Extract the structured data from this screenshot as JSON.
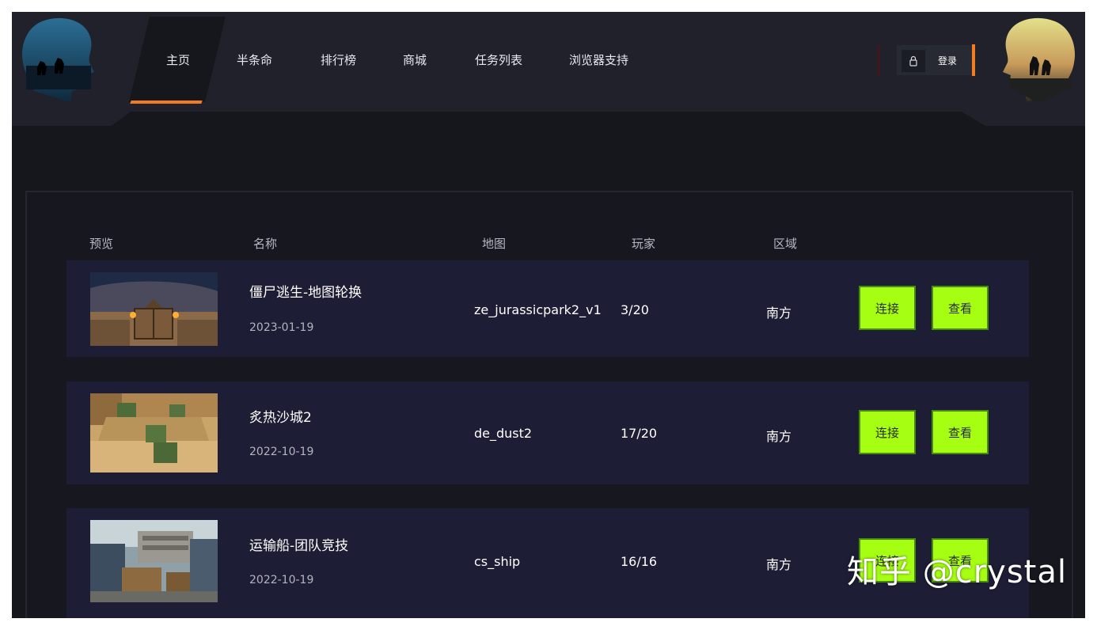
{
  "nav": {
    "items": [
      "主页",
      "半条命",
      "排行榜",
      "商城",
      "任务列表",
      "浏览器支持"
    ],
    "active_index": 0
  },
  "login": {
    "label": "登录",
    "icon": "lock-icon"
  },
  "table": {
    "headers": [
      "预览",
      "名称",
      "地图",
      "玩家",
      "区域"
    ],
    "rows": [
      {
        "name": "僵尸逃生-地图轮换",
        "date": "2023-01-19",
        "map": "ze_jurassicpark2_v1",
        "players": "3/20",
        "region": "南方",
        "connect": "连接",
        "view": "查看"
      },
      {
        "name": "炙热沙城2",
        "date": "2022-10-19",
        "map": "de_dust2",
        "players": "17/20",
        "region": "南方",
        "connect": "连接",
        "view": "查看"
      },
      {
        "name": "运输船-团队竞技",
        "date": "2022-10-19",
        "map": "cs_ship",
        "players": "16/16",
        "region": "南方",
        "connect": "连接",
        "view": "查看"
      }
    ]
  },
  "watermark": "知乎 @crystal",
  "colors": {
    "accent": "#f47c20",
    "button": "#a6ff12",
    "row_bg": "#1d1d35",
    "page_bg": "#16161d"
  }
}
